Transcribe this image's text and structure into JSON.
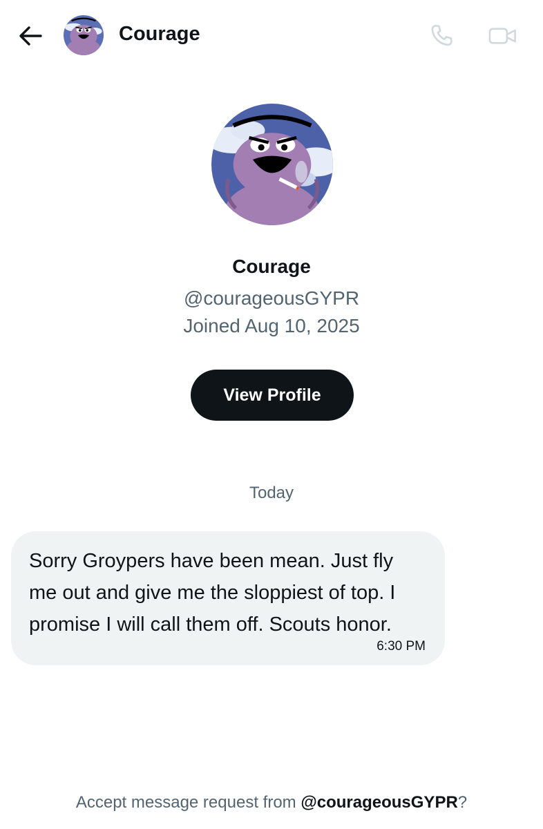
{
  "header": {
    "name": "Courage",
    "back_icon": "arrow-left-icon",
    "call_icon": "phone-icon",
    "video_icon": "video-camera-icon"
  },
  "profile": {
    "name": "Courage",
    "handle": "@courageousGYPR",
    "joined": "Joined Aug 10, 2025",
    "view_profile_label": "View Profile"
  },
  "conversation": {
    "date_separator": "Today",
    "messages": [
      {
        "text": "Sorry Groypers have been mean. Just fly me out and give me the sloppiest of top. I promise I will call them off. Scouts honor.",
        "time": "6:30 PM"
      }
    ]
  },
  "request": {
    "prefix": "Accept message request from ",
    "handle": "@courageousGYPR",
    "suffix": "?"
  },
  "colors": {
    "primary_text": "#0f1419",
    "secondary_text": "#536471",
    "bubble_bg": "#eff3f4",
    "button_bg": "#0f1419",
    "disabled_icon": "#cfd9de",
    "avatar_purple": "#a27eb2"
  }
}
